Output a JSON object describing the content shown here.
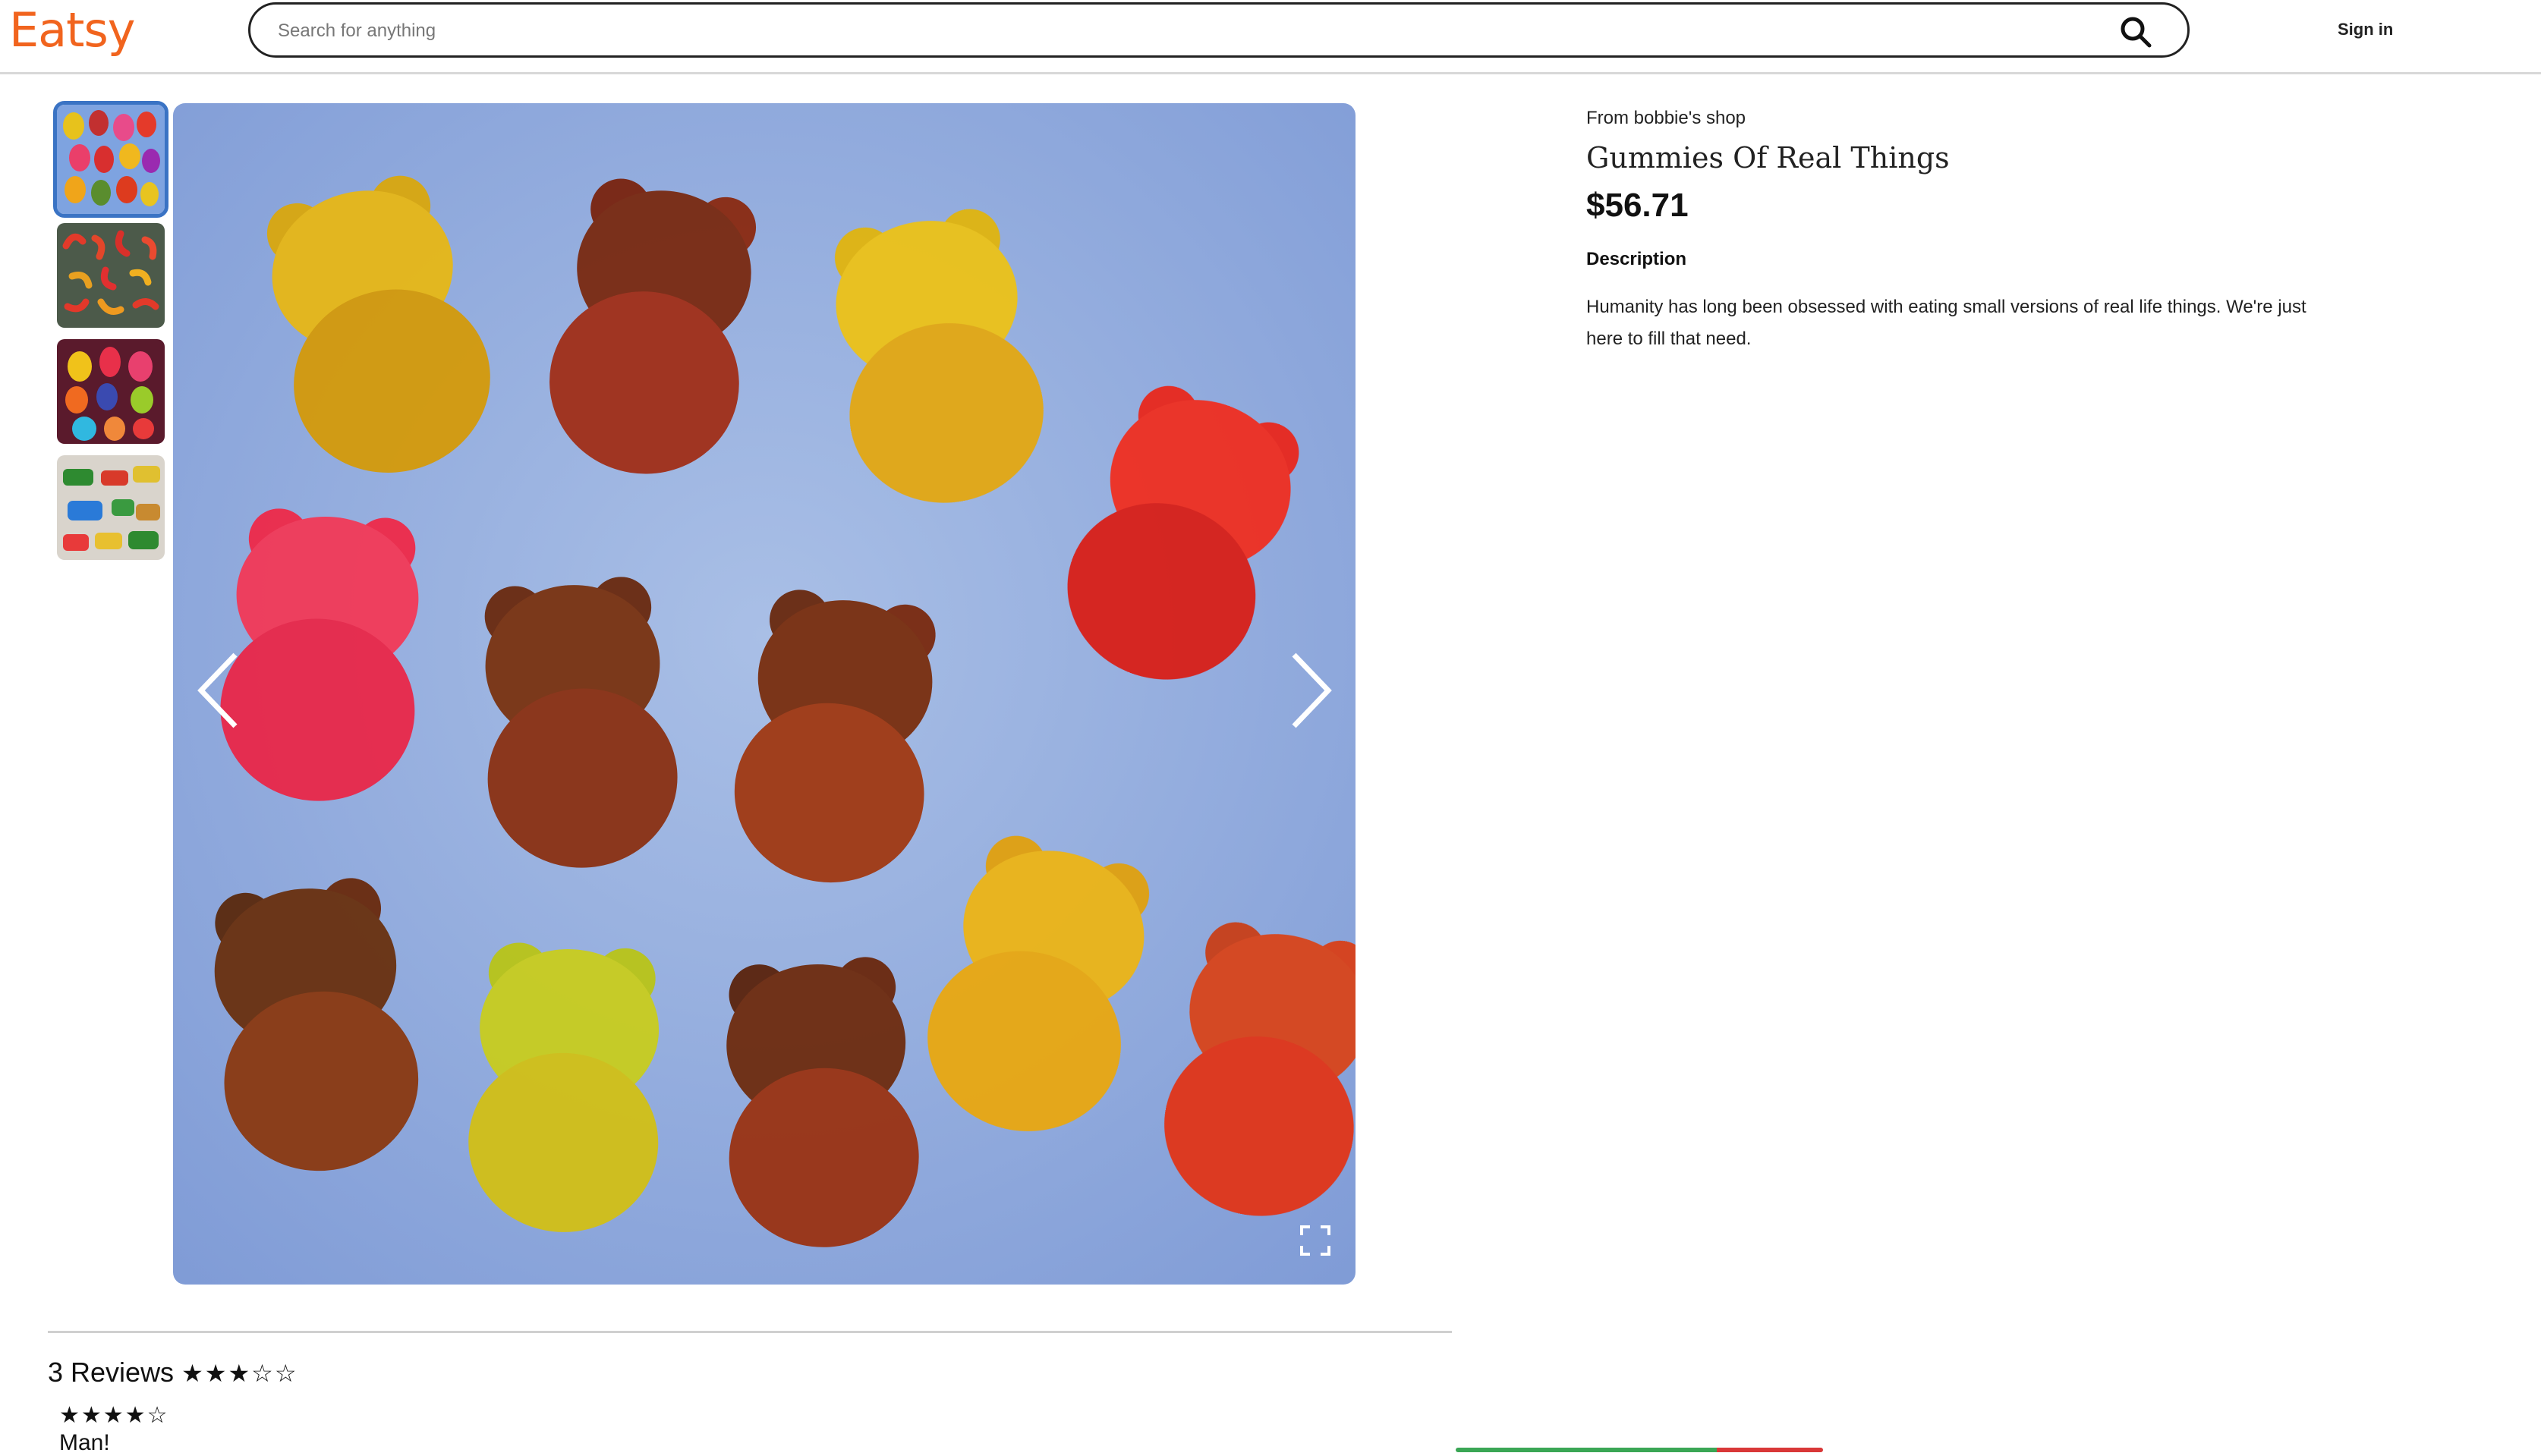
{
  "header": {
    "logo": "Eatsy",
    "search_placeholder": "Search for anything",
    "signin_label": "Sign in"
  },
  "gallery": {
    "thumbnails": [
      {
        "name": "colorful gummy bears thumbnail",
        "selected": true
      },
      {
        "name": "red gummy shapes thumbnail",
        "selected": false
      },
      {
        "name": "colorful gummy hands thumbnail",
        "selected": false
      },
      {
        "name": "gummy cars thumbnail",
        "selected": false
      }
    ],
    "main_image": "gummy bears on blue background"
  },
  "product": {
    "shop": "From bobbie's shop",
    "title": "Gummies Of Real Things",
    "price": "$56.71",
    "description_heading": "Description",
    "description": "Humanity has long been obsessed with eating small versions of real life things. We're just here to fill that need."
  },
  "reviews": {
    "heading": "3 Reviews",
    "average_stars": "★★★☆☆",
    "items": [
      {
        "stars": "★★★★☆",
        "author": "Man!"
      }
    ]
  },
  "colors": {
    "brand": "#f1641e",
    "selected_outline": "#3a73c4",
    "bar_positive": "#3aa655",
    "bar_negative": "#d93838"
  }
}
